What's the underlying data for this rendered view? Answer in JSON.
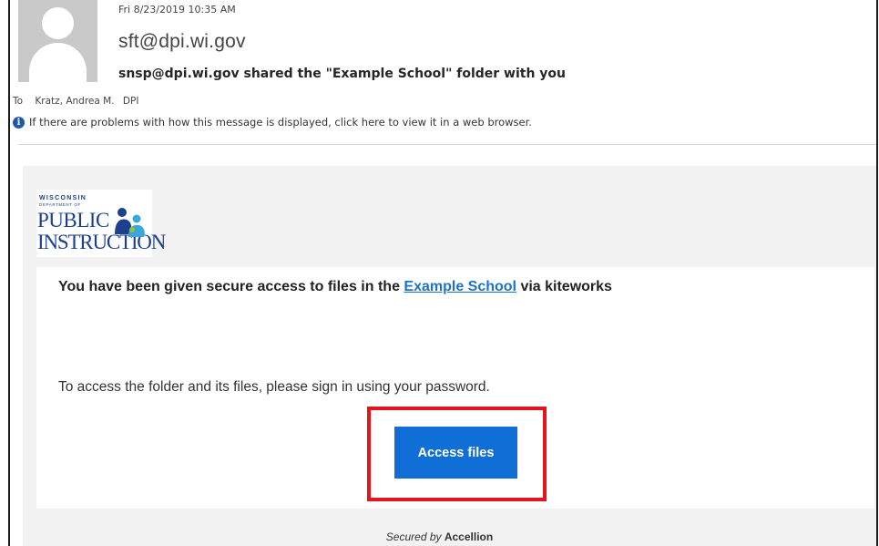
{
  "message": {
    "date": "Fri 8/23/2019 10:35 AM",
    "sender": "sft@dpi.wi.gov",
    "subject": "snsp@dpi.wi.gov shared the \"Example School\" folder with you",
    "to_label": "To",
    "to_name": "Kratz, Andrea M.",
    "to_org": "DPI",
    "info_notice": "If there are problems with how this message is displayed, click here to view it in a web browser."
  },
  "logo": {
    "line1": "WISCONSIN",
    "line2": "DEPARTMENT OF",
    "line3": "PUBLIC",
    "line4": "INSTRUCTION"
  },
  "body": {
    "headline_pre": "You have been given secure access to files in the ",
    "headline_link": "Example School",
    "headline_post": " via kiteworks",
    "instruction": "To access the folder and its files, please sign in using your password.",
    "button_label": "Access files"
  },
  "footer": {
    "prefix": "Secured by ",
    "brand": "Accellion"
  },
  "colors": {
    "button": "#0f6fd6",
    "link": "#1a73c8",
    "highlight": "#e3141c",
    "panel": "#f2f2f2"
  },
  "icons": {
    "info": "info-icon",
    "avatar": "user-avatar-placeholder"
  }
}
